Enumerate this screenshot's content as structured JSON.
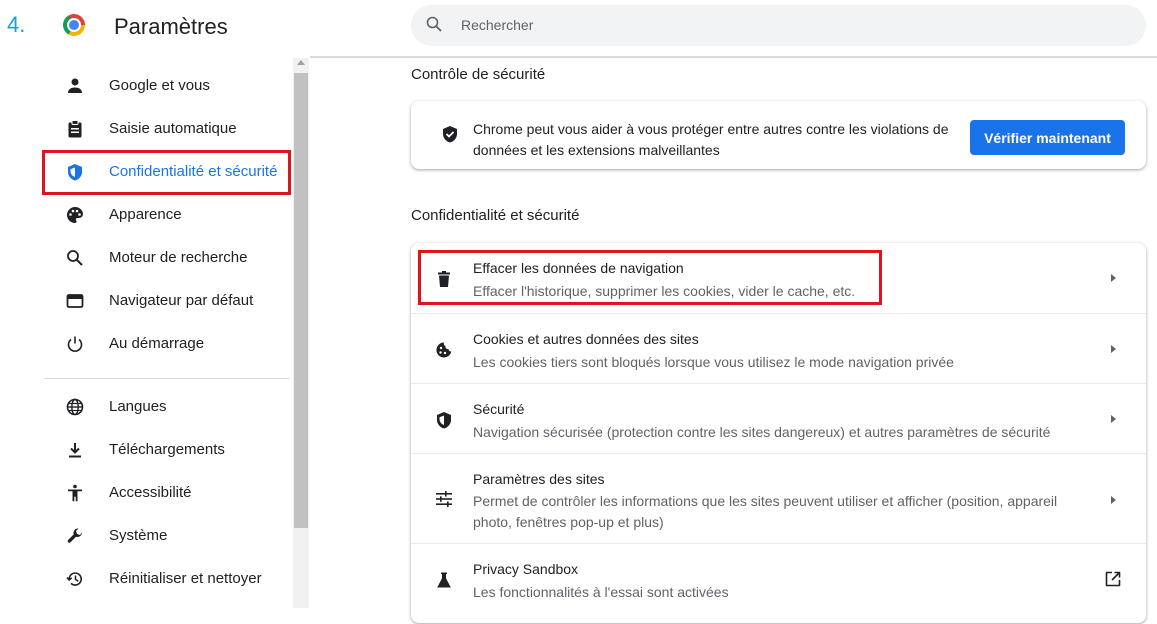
{
  "step_number": "4.",
  "app": {
    "title": "Paramètres"
  },
  "search": {
    "placeholder": "Rechercher"
  },
  "sidebar": {
    "items": [
      {
        "label": "Google et vous",
        "icon": "person-icon"
      },
      {
        "label": "Saisie automatique",
        "icon": "clipboard-icon"
      },
      {
        "label": "Confidentialité et sécurité",
        "icon": "shield-icon",
        "active": true
      },
      {
        "label": "Apparence",
        "icon": "palette-icon"
      },
      {
        "label": "Moteur de recherche",
        "icon": "search-icon"
      },
      {
        "label": "Navigateur par défaut",
        "icon": "browser-window-icon"
      },
      {
        "label": "Au démarrage",
        "icon": "power-icon"
      },
      {
        "label": "Langues",
        "icon": "globe-icon"
      },
      {
        "label": "Téléchargements",
        "icon": "download-icon"
      },
      {
        "label": "Accessibilité",
        "icon": "accessibility-icon"
      },
      {
        "label": "Système",
        "icon": "wrench-icon"
      },
      {
        "label": "Réinitialiser et nettoyer",
        "icon": "restore-icon"
      }
    ]
  },
  "safety_check": {
    "section_title": "Contrôle de sécurité",
    "text": "Chrome peut vous aider à vous protéger entre autres contre les violations de données et les extensions malveillantes",
    "button_label": "Vérifier maintenant"
  },
  "privacy": {
    "section_title": "Confidentialité et sécurité",
    "rows": [
      {
        "title": "Effacer les données de navigation",
        "subtitle": "Effacer l'historique, supprimer les cookies, vider le cache, etc.",
        "icon": "trash-icon"
      },
      {
        "title": "Cookies et autres données des sites",
        "subtitle": "Les cookies tiers sont bloqués lorsque vous utilisez le mode navigation privée",
        "icon": "cookie-icon"
      },
      {
        "title": "Sécurité",
        "subtitle": "Navigation sécurisée (protection contre les sites dangereux) et autres paramètres de sécurité",
        "icon": "shield-icon"
      },
      {
        "title": "Paramètres des sites",
        "subtitle": "Permet de contrôler les informations que les sites peuvent utiliser et afficher (position, appareil photo, fenêtres pop-up et plus)",
        "icon": "tune-icon"
      },
      {
        "title": "Privacy Sandbox",
        "subtitle": "Les fonctionnalités à l'essai sont activées",
        "icon": "flask-icon"
      }
    ]
  },
  "colors": {
    "accent": "#1a73e8",
    "highlight": "#e0121b",
    "step_number": "#1a9fd9"
  }
}
